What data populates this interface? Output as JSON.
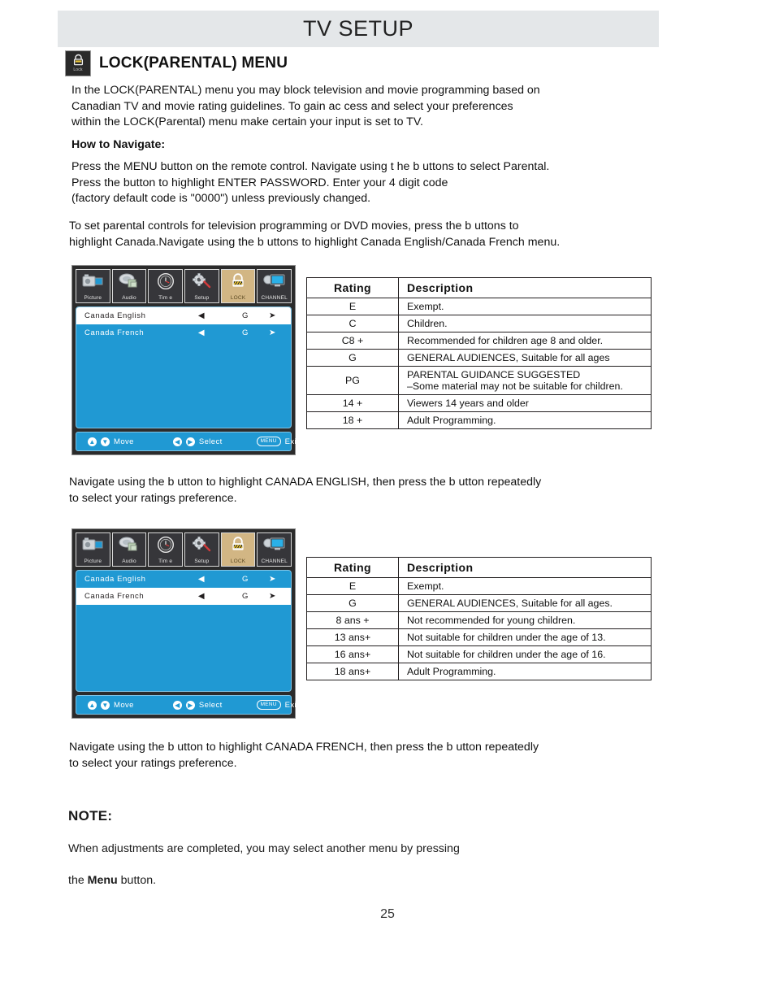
{
  "header": {
    "title": "TV SETUP"
  },
  "section": {
    "icon_caption": "Lock",
    "title": "LOCK(PARENTAL) MENU"
  },
  "intro": {
    "text": "In the LOCK(PARENTAL) menu you may block television and movie programming based on\nCanadian TV and movie rating guidelines. To gain ac cess and select your preferences\nwithin the LOCK(Parental) menu make certain your input is set to TV."
  },
  "how_to": {
    "heading": "How to Navigate:",
    "text": "Press the MENU button on the remote control. Navigate using t he     b    uttons to select Parental.\nPress the button to highlight ENTER PASSWORD. Enter your 4 digit code\n(factory default code is \"0000\") unless previously changed."
  },
  "set_controls": {
    "text": "To set parental controls for television programming or DVD movies, press the     b    uttons to\nhighlight Canada.Navigate using the     b    uttons to highlight Canada English/Canada French menu."
  },
  "osd_menu_1": {
    "tabs": [
      {
        "label": "Picture",
        "icon": "camera-icon",
        "active": false
      },
      {
        "label": "Audio",
        "icon": "speaker-icon",
        "active": false
      },
      {
        "label": "Tim e",
        "icon": "clock-icon",
        "active": false
      },
      {
        "label": "Setup",
        "icon": "gear-icon",
        "active": false
      },
      {
        "label": "LOCK",
        "icon": "padlock-icon",
        "active": true
      },
      {
        "label": "CHANNEL",
        "icon": "monitor-icon",
        "active": false
      }
    ],
    "rows": [
      {
        "label": "Canada English",
        "left_arrow": "◀",
        "value": "G",
        "right_arrow": "➤",
        "selected": true
      },
      {
        "label": "Canada French",
        "left_arrow": "◀",
        "value": "G",
        "right_arrow": "➤",
        "selected": false
      }
    ],
    "footer": {
      "move_label": "Move",
      "move_keys": [
        "▲",
        "▼"
      ],
      "select_label": "Select",
      "select_keys": [
        "◀",
        "▶"
      ],
      "exit_label": "Exit",
      "exit_key": "MENU"
    }
  },
  "osd_menu_2": {
    "tabs": [
      {
        "label": "Picture",
        "icon": "camera-icon",
        "active": false
      },
      {
        "label": "Audio",
        "icon": "speaker-icon",
        "active": false
      },
      {
        "label": "Tim e",
        "icon": "clock-icon",
        "active": false
      },
      {
        "label": "Setup",
        "icon": "gear-icon",
        "active": false
      },
      {
        "label": "LOCK",
        "icon": "padlock-icon",
        "active": true
      },
      {
        "label": "CHANNEL",
        "icon": "monitor-icon",
        "active": false
      }
    ],
    "rows": [
      {
        "label": "Canada English",
        "left_arrow": "◀",
        "value": "G",
        "right_arrow": "➤",
        "selected": false
      },
      {
        "label": "Canada French",
        "left_arrow": "◀",
        "value": "G",
        "right_arrow": "➤",
        "selected": true
      }
    ],
    "footer": {
      "move_label": "Move",
      "move_keys": [
        "▲",
        "▼"
      ],
      "select_label": "Select",
      "select_keys": [
        "◀",
        "▶"
      ],
      "exit_label": "Exit",
      "exit_key": "MENU"
    }
  },
  "table_english": {
    "headers": [
      "Rating",
      "Description"
    ],
    "rows": [
      {
        "rating": "E",
        "description": "Exempt."
      },
      {
        "rating": "C",
        "description": "Children."
      },
      {
        "rating": "C8 +",
        "description": "Recommended  for  children  age  8  and  older."
      },
      {
        "rating": "G",
        "description": "GENERAL AUDIENCES, Suitable for all ages"
      },
      {
        "rating": "PG",
        "description": "PARENTAL GUIDANCE SUGGESTED",
        "description2": "–Some material may not be suitable for children."
      },
      {
        "rating": "14 +",
        "description": "Viewers 14 years and older"
      },
      {
        "rating": "18 +",
        "description": "Adult Programming."
      }
    ]
  },
  "table_french": {
    "headers": [
      "Rating",
      "Description"
    ],
    "rows": [
      {
        "rating": "E",
        "description": "Exempt."
      },
      {
        "rating": "G",
        "description": "GENERAL AUDIENCES, Suitable for all ages."
      },
      {
        "rating": "8 ans +",
        "description": "Not  recommended  for  young  children."
      },
      {
        "rating": "13 ans+",
        "description": "Not suitable for children under the age of 13."
      },
      {
        "rating": "16 ans+",
        "description": "Not suitable for children under the age of 16."
      },
      {
        "rating": "18 ans+",
        "description": "Adult Programming."
      }
    ]
  },
  "caption_english": {
    "text": "Navigate using the  b    utton to highlight CANADA ENGLISH, then press the  b    utton repeatedly\nto select your ratings preference."
  },
  "caption_french": {
    "text": "Navigate using the  b    utton to highlight CANADA FRENCH, then press the  b    utton repeatedly\nto select your ratings preference."
  },
  "note": {
    "title": "NOTE:",
    "line1": "When adjustments are completed, you may select another menu by pressing",
    "line2_before": "the ",
    "line2_bold": "Menu",
    "line2_after": " button."
  },
  "page": {
    "number": "25"
  },
  "colors": {
    "header_band": "#e4e7e9",
    "osd_blue": "#2099d3",
    "osd_tab_active": "#d2b684",
    "osd_frame": "#2b2b2b",
    "text": "#111111"
  }
}
